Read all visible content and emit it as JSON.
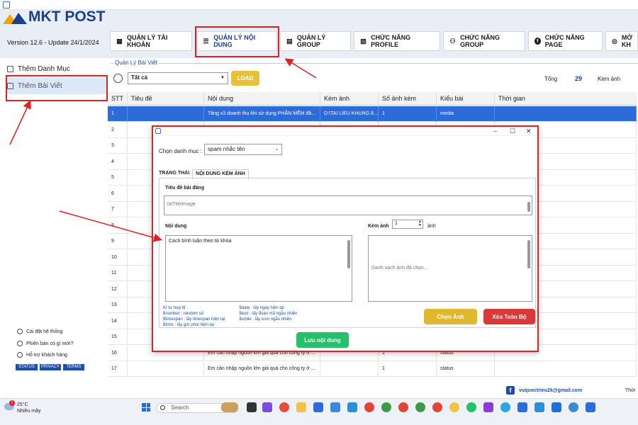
{
  "app": {
    "logo": "MKT POST",
    "version": "Version  12.6  - Update  24/1/2024"
  },
  "tabs": [
    {
      "label": "QUẢN LÝ TÀI KHOẢN"
    },
    {
      "label": "QUẢN LÝ NỘI DUNG"
    },
    {
      "label": "QUẢN LÝ GROUP"
    },
    {
      "label": "CHỨC NĂNG PROFILE"
    },
    {
      "label": "CHỨC NĂNG GROUP"
    },
    {
      "label": "CHỨC NĂNG PAGE"
    },
    {
      "label": "MỞ KH"
    }
  ],
  "sidebar": {
    "items": [
      {
        "label": "Thêm Danh Mục"
      },
      {
        "label": "Thêm Bài Viết"
      }
    ],
    "footer": [
      {
        "label": "Cài đặt hệ thống"
      },
      {
        "label": "Phiên bản có gì mới?"
      },
      {
        "label": "Hỗ trợ khách hàng"
      }
    ],
    "pills": [
      "STATUS",
      "PRIVACY",
      "TERMS"
    ]
  },
  "main": {
    "group_title": "Quản Lý Bài Viết",
    "filter_value": "Tất cả",
    "load_label": "LOAD",
    "total_label": "Tổng",
    "total_value": "29",
    "kem_anh_label": "Kèm ảnh",
    "columns": [
      "STT",
      "Tiêu đề",
      "Nội dung",
      "Kèm ảnh",
      "Số ảnh kèm",
      "Kiểu bài",
      "Thời gian"
    ],
    "rows": [
      {
        "stt": "1",
        "title": "",
        "content": "Tăng x3 doanh thu khi sử dụng PHẦN MỀM đă...",
        "image": "D:\\TAI LIEU KHUNG 8...",
        "count": "1",
        "type": "media",
        "time": ""
      },
      {
        "stt": "2",
        "title": "",
        "content": "",
        "image": "",
        "count": "",
        "type": "",
        "time": ""
      },
      {
        "stt": "3",
        "title": "",
        "content": "",
        "image": "",
        "count": "",
        "type": "",
        "time": ""
      },
      {
        "stt": "4",
        "title": "",
        "content": "",
        "image": "",
        "count": "",
        "type": "",
        "time": ""
      },
      {
        "stt": "5",
        "title": "",
        "content": "",
        "image": "",
        "count": "",
        "type": "",
        "time": ""
      },
      {
        "stt": "6",
        "title": "",
        "content": "",
        "image": "",
        "count": "",
        "type": "",
        "time": ""
      },
      {
        "stt": "7",
        "title": "",
        "content": "",
        "image": "",
        "count": "",
        "type": "",
        "time": ""
      },
      {
        "stt": "8",
        "title": "",
        "content": "",
        "image": "",
        "count": "",
        "type": "",
        "time": ""
      },
      {
        "stt": "9",
        "title": "",
        "content": "",
        "image": "",
        "count": "",
        "type": "",
        "time": ""
      },
      {
        "stt": "10",
        "title": "",
        "content": "",
        "image": "",
        "count": "",
        "type": "",
        "time": ""
      },
      {
        "stt": "11",
        "title": "",
        "content": "",
        "image": "",
        "count": "",
        "type": "",
        "time": ""
      },
      {
        "stt": "12",
        "title": "",
        "content": "",
        "image": "",
        "count": "",
        "type": "",
        "time": ""
      },
      {
        "stt": "13",
        "title": "",
        "content": "",
        "image": "",
        "count": "",
        "type": "",
        "time": ""
      },
      {
        "stt": "14",
        "title": "",
        "content": "",
        "image": "",
        "count": "",
        "type": "",
        "time": ""
      },
      {
        "stt": "15",
        "title": "",
        "content": "",
        "image": "",
        "count": "",
        "type": "",
        "time": ""
      },
      {
        "stt": "16",
        "title": "",
        "content": "Em cần nhập nguồn lớn giá quà cho công ty ở ...",
        "image": "",
        "count": "1",
        "type": "status",
        "time": ""
      },
      {
        "stt": "17",
        "title": "",
        "content": "Em cần nhập nguồn lớn giá quà cho công ty ở ...",
        "image": "",
        "count": "1",
        "type": "status",
        "time": ""
      }
    ],
    "footer_email": "vuquoctrieu2k@gmail.com",
    "footer_thoi": "Thời"
  },
  "dialog": {
    "category_label": "Chọn danh mục :",
    "category_value": "spam nhắc tên",
    "tab_status": "TRẠNG THÁI",
    "tab_content": "NỘI DUNG KÈM ẢNH",
    "title_label": "Tiêu đề bài đăng",
    "title_placeholder": "txtTitleImage",
    "content_label": "Nội dung",
    "content_value": "Cách bình luận theo từ khóa",
    "attach_label": "Kèm ảnh",
    "attach_value": "1",
    "attach_unit": "ảnh",
    "images_placeholder": "Danh sách ảnh đã chọn...",
    "legend_title": "Kí tự hợp lệ :",
    "legend": [
      "$number   : random số",
      "$timespan  : lấy timespan hiện tại",
      "$time      : lấy giờ phút hiện tại",
      "$date : lấy ngày hiện tại",
      "$text : lấy đoạn mã ngẫu nhiên",
      "$smile : lấy icon ngẫu nhiên"
    ],
    "choose_image": "Chọn Ảnh",
    "delete_all": "Xóa Toàn Bộ",
    "save": "Lưu nội dung"
  },
  "taskbar": {
    "temp": "25°C",
    "weather": "Nhiều mây",
    "search_placeholder": "Search",
    "badge": "1"
  }
}
